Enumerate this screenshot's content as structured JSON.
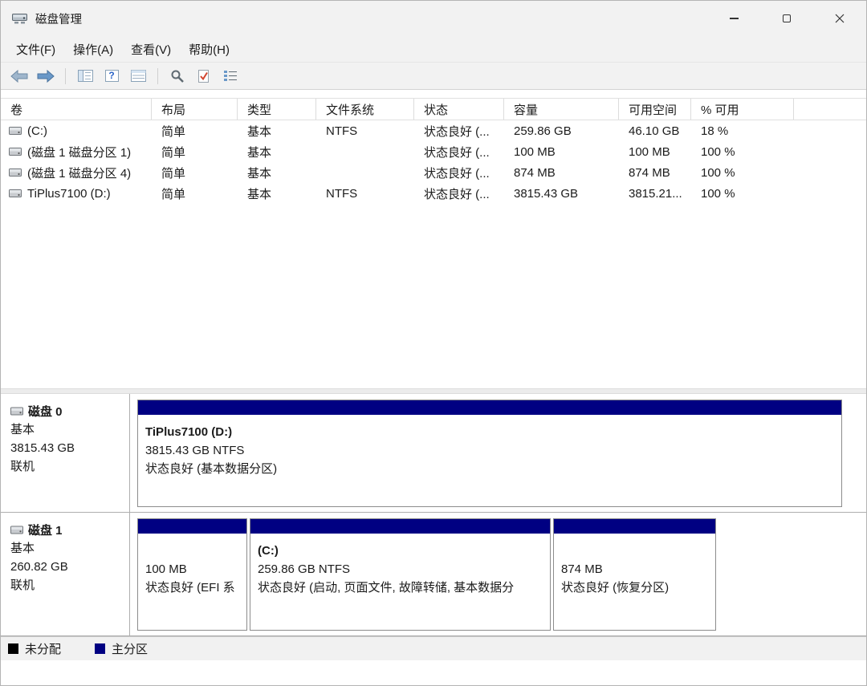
{
  "window": {
    "title": "磁盘管理"
  },
  "menu": {
    "items": [
      {
        "label": "文件(F)"
      },
      {
        "label": "操作(A)"
      },
      {
        "label": "查看(V)"
      },
      {
        "label": "帮助(H)"
      }
    ]
  },
  "toolbar": {
    "icons": [
      "back-icon",
      "forward-icon",
      "console-tree-icon",
      "help-icon",
      "export-list-icon",
      "magnifier-icon",
      "check-document-icon",
      "action-pane-icon"
    ]
  },
  "table": {
    "columns": [
      "卷",
      "布局",
      "类型",
      "文件系统",
      "状态",
      "容量",
      "可用空间",
      "% 可用"
    ],
    "rows": [
      {
        "volume": "(C:)",
        "layout": "简单",
        "type": "基本",
        "filesystem": "NTFS",
        "status": "状态良好 (...",
        "capacity": "259.86 GB",
        "free_space": "46.10 GB",
        "pct_free": "18 %"
      },
      {
        "volume": "(磁盘 1 磁盘分区 1)",
        "layout": "简单",
        "type": "基本",
        "filesystem": "",
        "status": "状态良好 (...",
        "capacity": "100 MB",
        "free_space": "100 MB",
        "pct_free": "100 %"
      },
      {
        "volume": "(磁盘 1 磁盘分区 4)",
        "layout": "简单",
        "type": "基本",
        "filesystem": "",
        "status": "状态良好 (...",
        "capacity": "874 MB",
        "free_space": "874 MB",
        "pct_free": "100 %"
      },
      {
        "volume": "TiPlus7100 (D:)",
        "layout": "简单",
        "type": "基本",
        "filesystem": "NTFS",
        "status": "状态良好 (...",
        "capacity": "3815.43 GB",
        "free_space": "3815.21...",
        "pct_free": "100 %"
      }
    ]
  },
  "disks": [
    {
      "name": "磁盘 0",
      "type": "基本",
      "size": "3815.43 GB",
      "status": "联机",
      "partitions": [
        {
          "title": "TiPlus7100 (D:)",
          "size": "3815.43 GB NTFS",
          "status": "状态良好 (基本数据分区)"
        }
      ]
    },
    {
      "name": "磁盘 1",
      "type": "基本",
      "size": "260.82 GB",
      "status": "联机",
      "partitions": [
        {
          "title": "",
          "size": "100 MB",
          "status": "状态良好 (EFI 系"
        },
        {
          "title": "(C:)",
          "size": "259.86 GB NTFS",
          "status": "状态良好 (启动, 页面文件, 故障转储, 基本数据分"
        },
        {
          "title": "",
          "size": "874 MB",
          "status": "状态良好 (恢复分区)"
        }
      ]
    }
  ],
  "legend": {
    "items": [
      {
        "label": "未分配",
        "color": "#000000"
      },
      {
        "label": "主分区",
        "color": "#000082"
      }
    ]
  },
  "colors": {
    "primary_partition": "#000082",
    "unallocated": "#000000",
    "chrome_background": "#f2f2f2"
  }
}
